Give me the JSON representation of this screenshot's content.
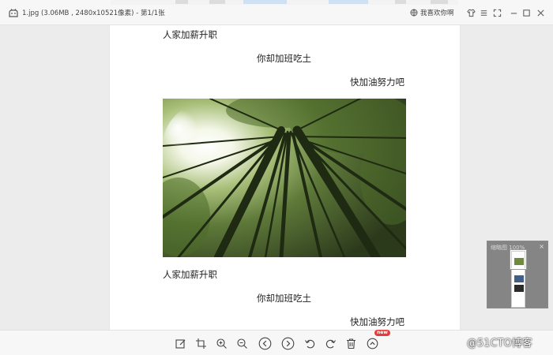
{
  "titlebar": {
    "file_info": "1.jpg (3.06MB , 2480x10521像素) - 第1/1张",
    "favorite_label": "我喜欢你啊"
  },
  "document": {
    "lines_top": [
      "人家加薪升职",
      "你却加班吃土",
      "快加油努力吧"
    ],
    "lines_bottom": [
      "人家加薪升职",
      "你却加班吃土",
      "快加油努力吧"
    ]
  },
  "navigator": {
    "label": "缩略图 100%",
    "close_label": "×"
  },
  "toolbar": {
    "new_badge": "new",
    "tools": [
      "edit-icon",
      "crop-icon",
      "zoom-in-icon",
      "zoom-out-icon",
      "previous-icon",
      "next-icon",
      "rotate-left-icon",
      "rotate-right-icon",
      "delete-icon",
      "more-icon"
    ]
  },
  "watermark": "@51CTO博客",
  "colors": {
    "badge": "#e83a3a",
    "toolbar_bg": "#f7f7f7",
    "viewport_bg": "#ececec"
  }
}
